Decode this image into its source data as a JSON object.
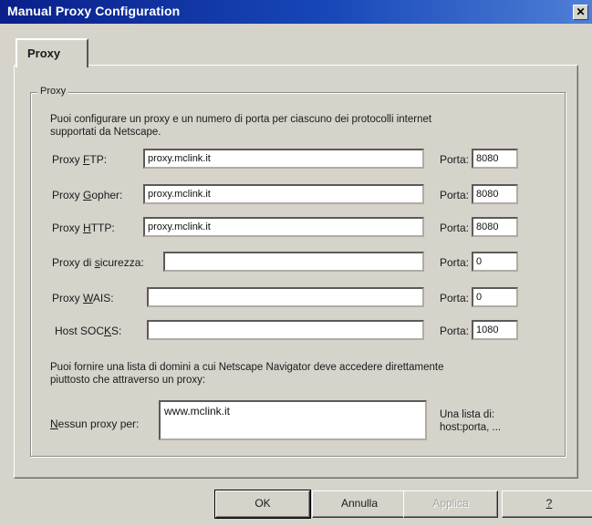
{
  "window": {
    "title": "Manual Proxy Configuration",
    "close_glyph": "✕"
  },
  "tabs": [
    {
      "label": "Proxy"
    }
  ],
  "group": {
    "label": "Proxy",
    "intro_line1": "Puoi configurare un proxy e un numero di porta per ciascuno dei protocolli internet",
    "intro_line2": "supportati da Netscape.",
    "rows": [
      {
        "label_pre": "Proxy ",
        "label_key": "F",
        "label_post": "TP:",
        "value": "proxy.mclink.it",
        "port_label": "Porta:",
        "port": "8080"
      },
      {
        "label_pre": "Proxy ",
        "label_key": "G",
        "label_post": "opher:",
        "value": "proxy.mclink.it",
        "port_label": "Porta:",
        "port": "8080"
      },
      {
        "label_pre": "Proxy ",
        "label_key": "H",
        "label_post": "TTP:",
        "value": "proxy.mclink.it",
        "port_label": "Porta:",
        "port": "8080"
      },
      {
        "label_pre": "Proxy di ",
        "label_key": "s",
        "label_post": "icurezza:",
        "value": "",
        "port_label": "Porta:",
        "port": "0"
      },
      {
        "label_pre": "Proxy ",
        "label_key": "W",
        "label_post": "AIS:",
        "value": "",
        "port_label": "Porta:",
        "port": "0"
      },
      {
        "label_pre": "Host SOC",
        "label_key": "K",
        "label_post": "S:",
        "value": "",
        "port_label": "Porta:",
        "port": "1080"
      }
    ],
    "noproxy_line1": "Puoi fornire una lista di domini a cui Netscape Navigator deve accedere direttamente",
    "noproxy_line2": "piuttosto che attraverso un proxy:",
    "noproxy_label_key": "N",
    "noproxy_label_rest": "essun proxy per:",
    "noproxy_value": "www.mclink.it",
    "hint_line1": "Una lista di:",
    "hint_line2": "host:porta, ..."
  },
  "buttons": {
    "ok": "OK",
    "cancel": "Annulla",
    "apply": "Applica",
    "help": "?"
  }
}
